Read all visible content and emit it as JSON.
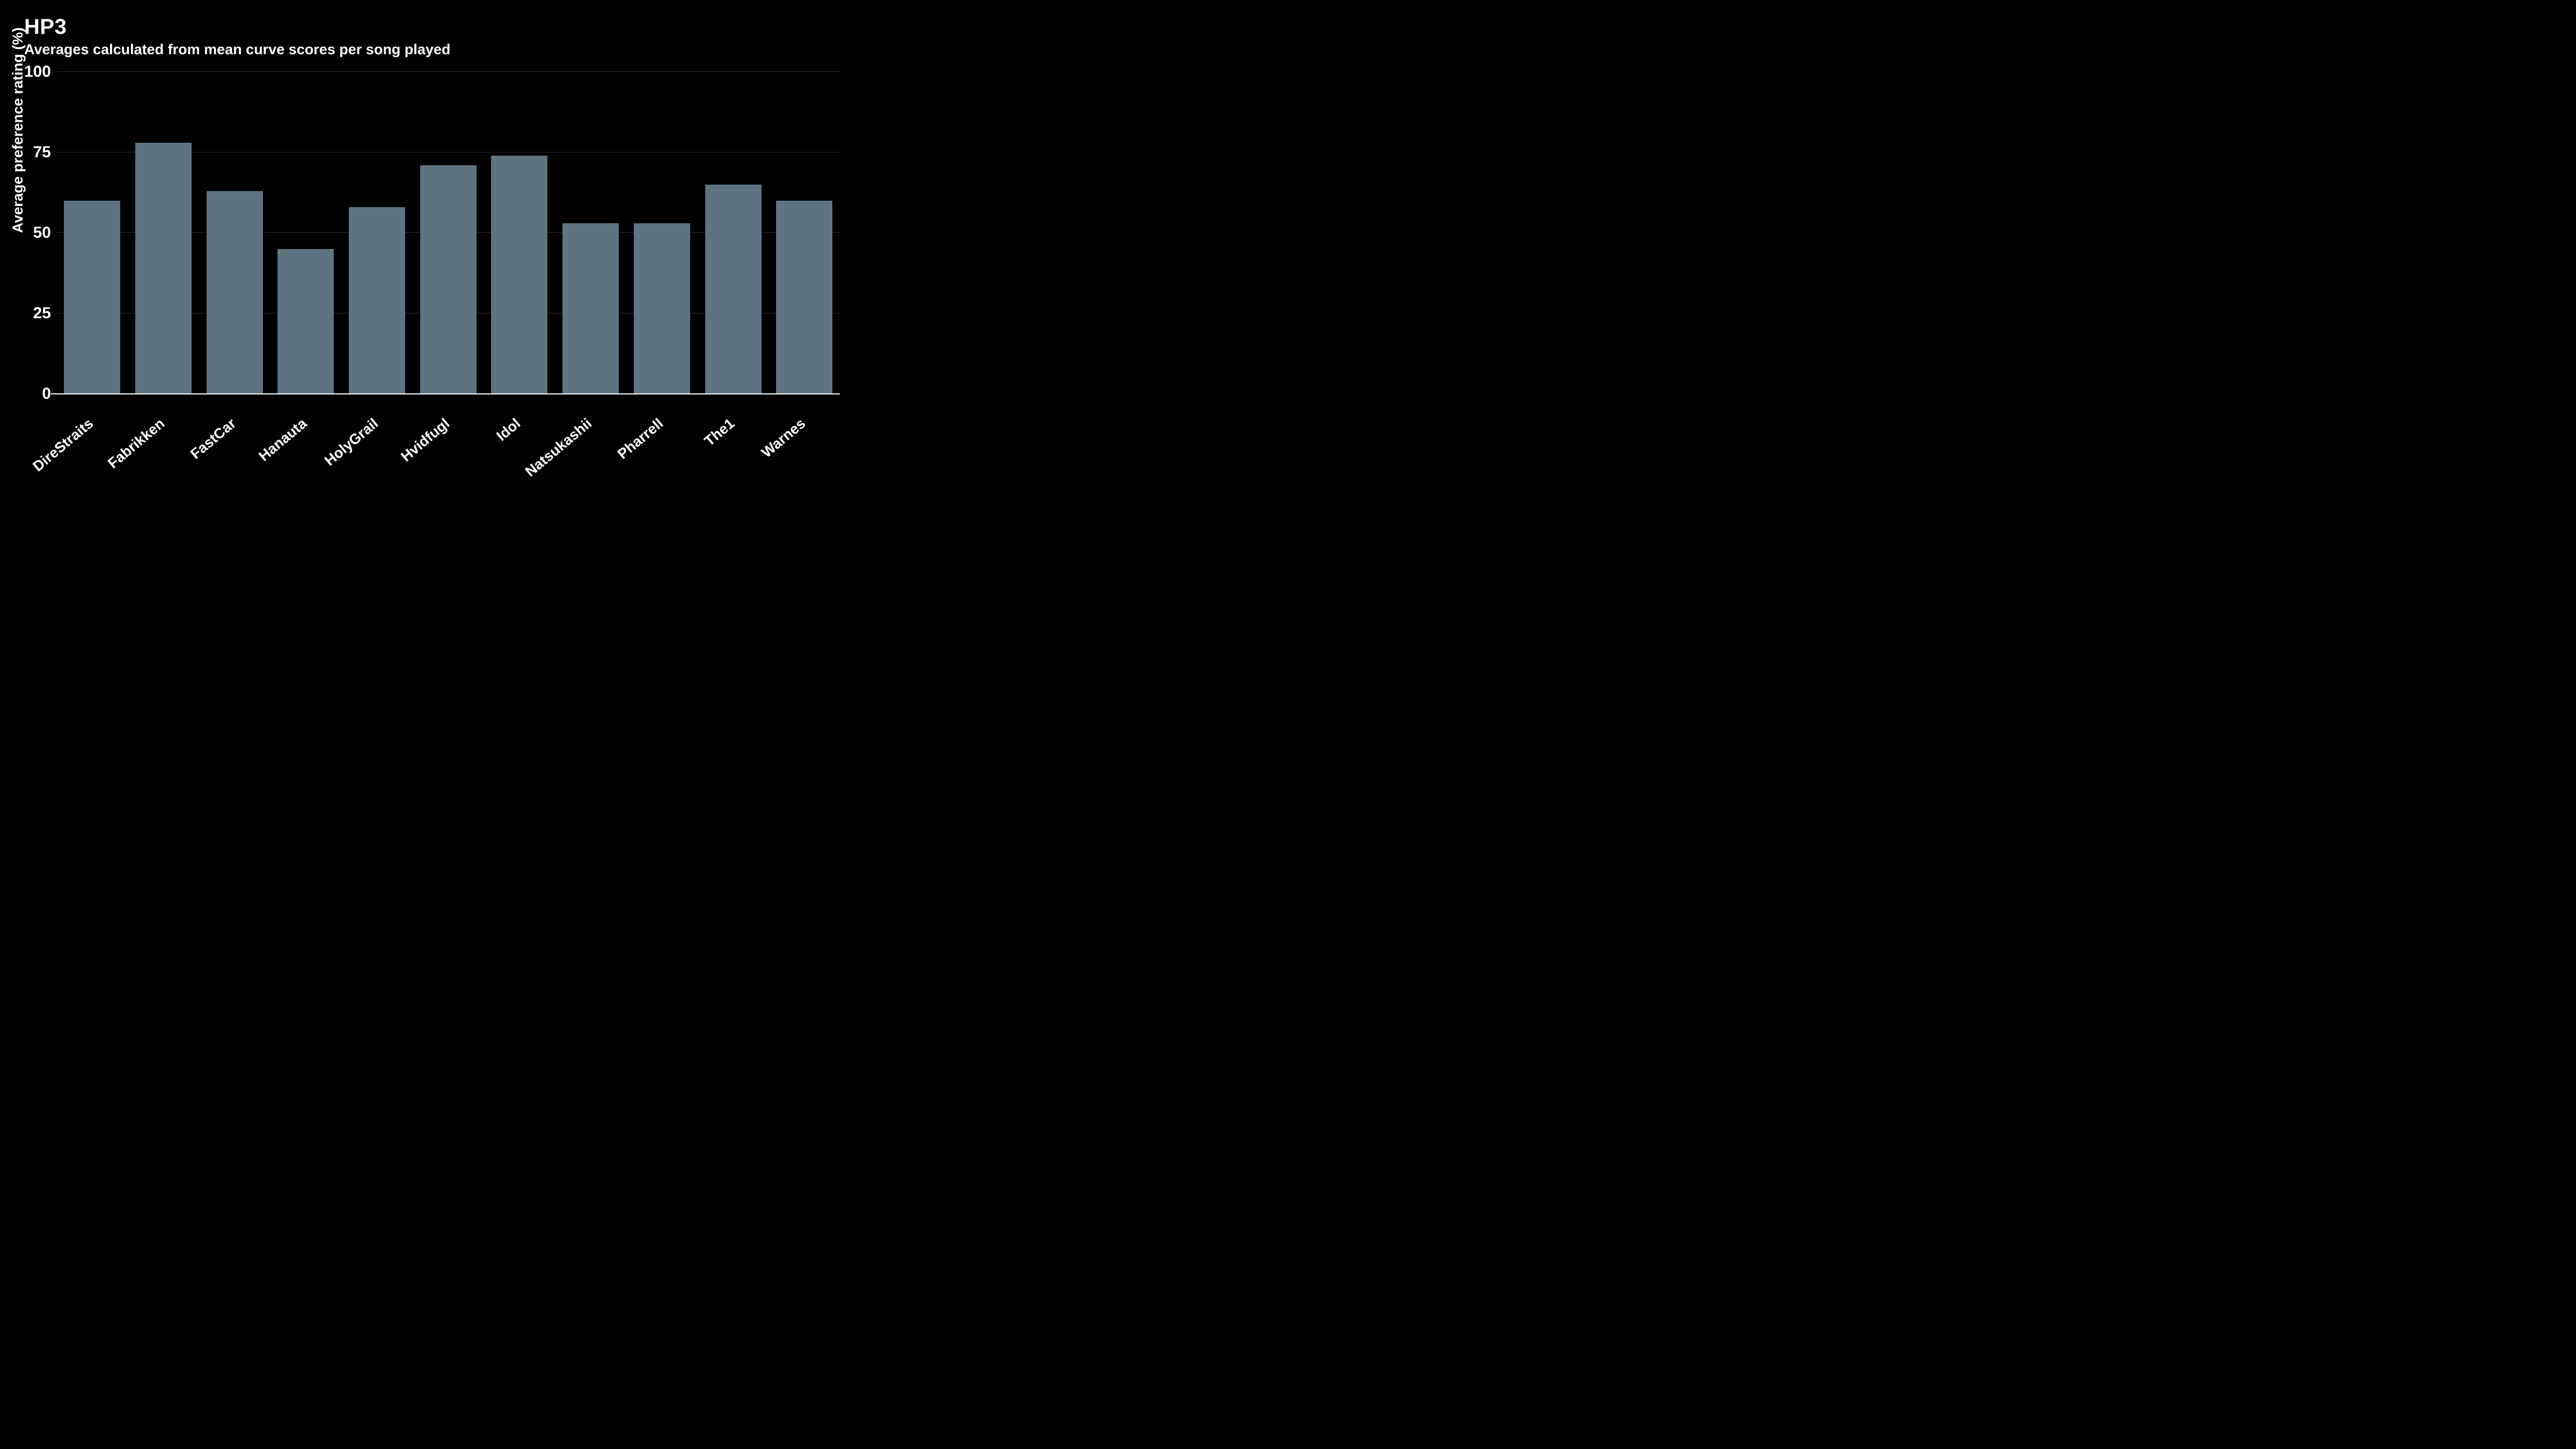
{
  "chart_data": {
    "type": "bar",
    "title": "HP3",
    "subtitle": "Averages calculated from mean curve scores per song played",
    "ylabel": "Average preference rating (%)",
    "xlabel": "",
    "ylim": [
      0,
      100
    ],
    "yticks": [
      0,
      25,
      50,
      75,
      100
    ],
    "categories": [
      "DireStraits",
      "Fabrikken",
      "FastCar",
      "Hanauta",
      "HolyGrail",
      "Hvidfugl",
      "Idol",
      "Natsukashii",
      "Pharrell",
      "The1",
      "Warnes"
    ],
    "values": [
      60,
      78,
      63,
      45,
      58,
      71,
      74,
      53,
      53,
      65,
      60
    ],
    "bar_color": "#5e7481",
    "grid": true
  }
}
